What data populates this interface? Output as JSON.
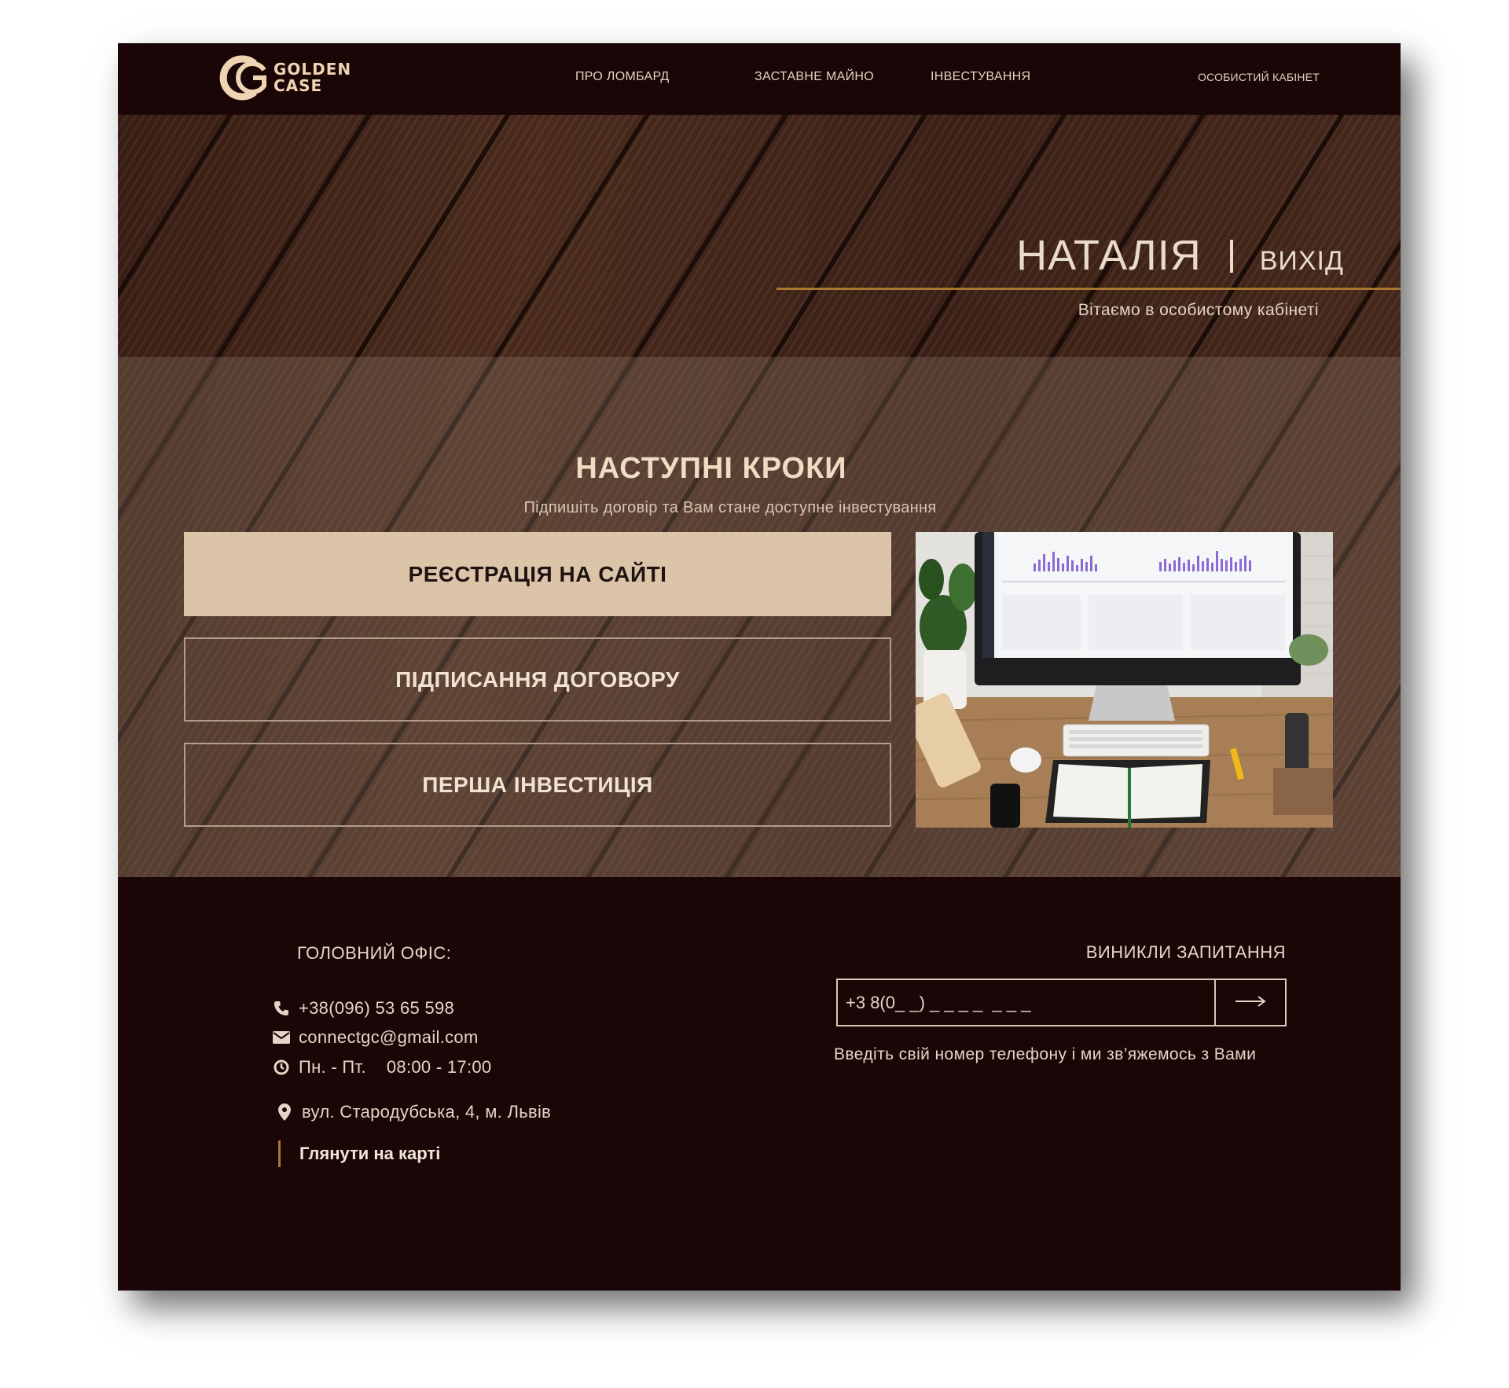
{
  "brand": {
    "line1": "GOLDEN",
    "line2": "CASE"
  },
  "nav": {
    "items": [
      {
        "label": "ПРО ЛОМБАРД"
      },
      {
        "label": "ЗАСТАВНЕ МАЙНО"
      },
      {
        "label": "ІНВЕСТУВАННЯ"
      }
    ],
    "cabinet": "ОСОБИСТИЙ КАБІНЕТ"
  },
  "greeting": {
    "name": "НАТАЛІЯ",
    "logout": "ВИХІД",
    "subtitle": "Вітаємо в особистому кабінеті"
  },
  "steps": {
    "title": "НАСТУПНІ КРОКИ",
    "subtitle": "Підпишіть договір та Вам стане доступне інвестування",
    "buttons": [
      {
        "label": "РЕЄСТРАЦІЯ НА САЙТІ"
      },
      {
        "label": "ПІДПИСАННЯ ДОГОВОРУ"
      },
      {
        "label": "ПЕРША ІНВЕСТИЦІЯ"
      }
    ]
  },
  "footer": {
    "office_title": "ГОЛОВНИЙ ОФІС:",
    "phone": "+38(096) 53 65 598",
    "email": "connectgc@gmail.com",
    "hours_days": "Пн. - Пт.",
    "hours_time": "08:00 - 17:00",
    "address": "вул.  Стародубська, 4, м. Львів",
    "map_link": "Глянути на карті",
    "question_title": "ВИНИКЛИ ЗАПИТАННЯ",
    "phone_placeholder": "+3 8(0_ _) _ _ _ _  _ _ _",
    "hint": "Введіть свій номер телефону і ми зв’яжемось з Вами"
  },
  "colors": {
    "background": "#1b0607",
    "accent_gold": "#a8782f",
    "primary_button": "#dcc4a9",
    "text_light": "#e4d5c6"
  },
  "icons": [
    "phone-icon",
    "mail-icon",
    "clock-icon",
    "location-pin-icon",
    "arrow-right-icon"
  ]
}
